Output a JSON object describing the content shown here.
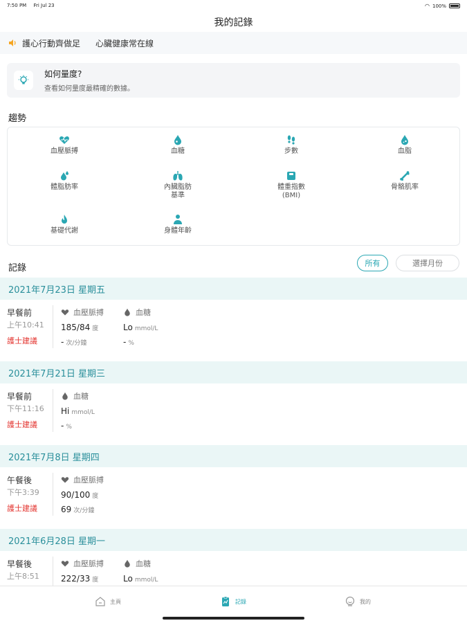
{
  "status_bar": {
    "time": "7:50 PM",
    "date": "Fri Jul 23",
    "battery": "100%"
  },
  "page_title": "我的記錄",
  "marquee": {
    "messages": [
      "護心行動齊做足",
      "心臟健康常在線"
    ]
  },
  "howto": {
    "title": "如何量度?",
    "subtitle": "查看如何量度最精確的數據。"
  },
  "trends": {
    "title": "趨勢",
    "items": [
      {
        "label": "血壓脈搏",
        "icon": "heart-icon"
      },
      {
        "label": "血糖",
        "icon": "blood-drop-icon"
      },
      {
        "label": "步數",
        "icon": "footsteps-icon"
      },
      {
        "label": "血脂",
        "icon": "lipid-drop-icon"
      },
      {
        "label": "體脂肪率",
        "icon": "body-fat-icon"
      },
      {
        "label": "內臟脂肪\n基準",
        "icon": "lungs-icon"
      },
      {
        "label": "體重指數\n(BMI)",
        "icon": "scale-icon"
      },
      {
        "label": "骨骼肌率",
        "icon": "bone-icon"
      },
      {
        "label": "基礎代謝",
        "icon": "flame-icon"
      },
      {
        "label": "身體年齡",
        "icon": "person-icon"
      }
    ]
  },
  "records_section": {
    "title": "記錄",
    "filter_all": "所有",
    "filter_month": "選擇月份"
  },
  "records": [
    {
      "date": "2021年7月23日 星期五",
      "meal": "早餐前",
      "time": "上午10:41",
      "advice": "護士建議",
      "columns": [
        {
          "title": "血壓脈搏",
          "icon": "heart-icon",
          "v1": "185/84",
          "u1": "度",
          "v2": "-",
          "u2": "次/分鐘"
        },
        {
          "title": "血糖",
          "icon": "blood-drop-icon",
          "v1": "Lo",
          "u1": "mmol/L",
          "v2": "-",
          "u2": "%"
        }
      ]
    },
    {
      "date": "2021年7月21日 星期三",
      "meal": "早餐前",
      "time": "下午11:16",
      "advice": "護士建議",
      "columns": [
        {
          "title": "血糖",
          "icon": "blood-drop-icon",
          "v1": "Hi",
          "u1": "mmol/L",
          "v2": "-",
          "u2": "%"
        }
      ]
    },
    {
      "date": "2021年7月8日 星期四",
      "meal": "午餐後",
      "time": "下午3:39",
      "advice": "護士建議",
      "columns": [
        {
          "title": "血壓脈搏",
          "icon": "heart-icon",
          "v1": "90/100",
          "u1": "度",
          "v2": "69",
          "u2": "次/分鐘"
        }
      ]
    },
    {
      "date": "2021年6月28日 星期一",
      "meal": "早餐後",
      "time": "上午8:51",
      "advice": "",
      "columns": [
        {
          "title": "血壓脈搏",
          "icon": "heart-icon",
          "v1": "222/33",
          "u1": "度",
          "v2": "",
          "u2": ""
        },
        {
          "title": "血糖",
          "icon": "blood-drop-icon",
          "v1": "Lo",
          "u1": "mmol/L",
          "v2": "",
          "u2": ""
        }
      ]
    }
  ],
  "tabbar": {
    "home": "主頁",
    "records": "記錄",
    "mine": "我的"
  },
  "colors": {
    "accent": "#2aa7b3",
    "advice_red": "#e3342f",
    "band": "#eaf6f6"
  }
}
